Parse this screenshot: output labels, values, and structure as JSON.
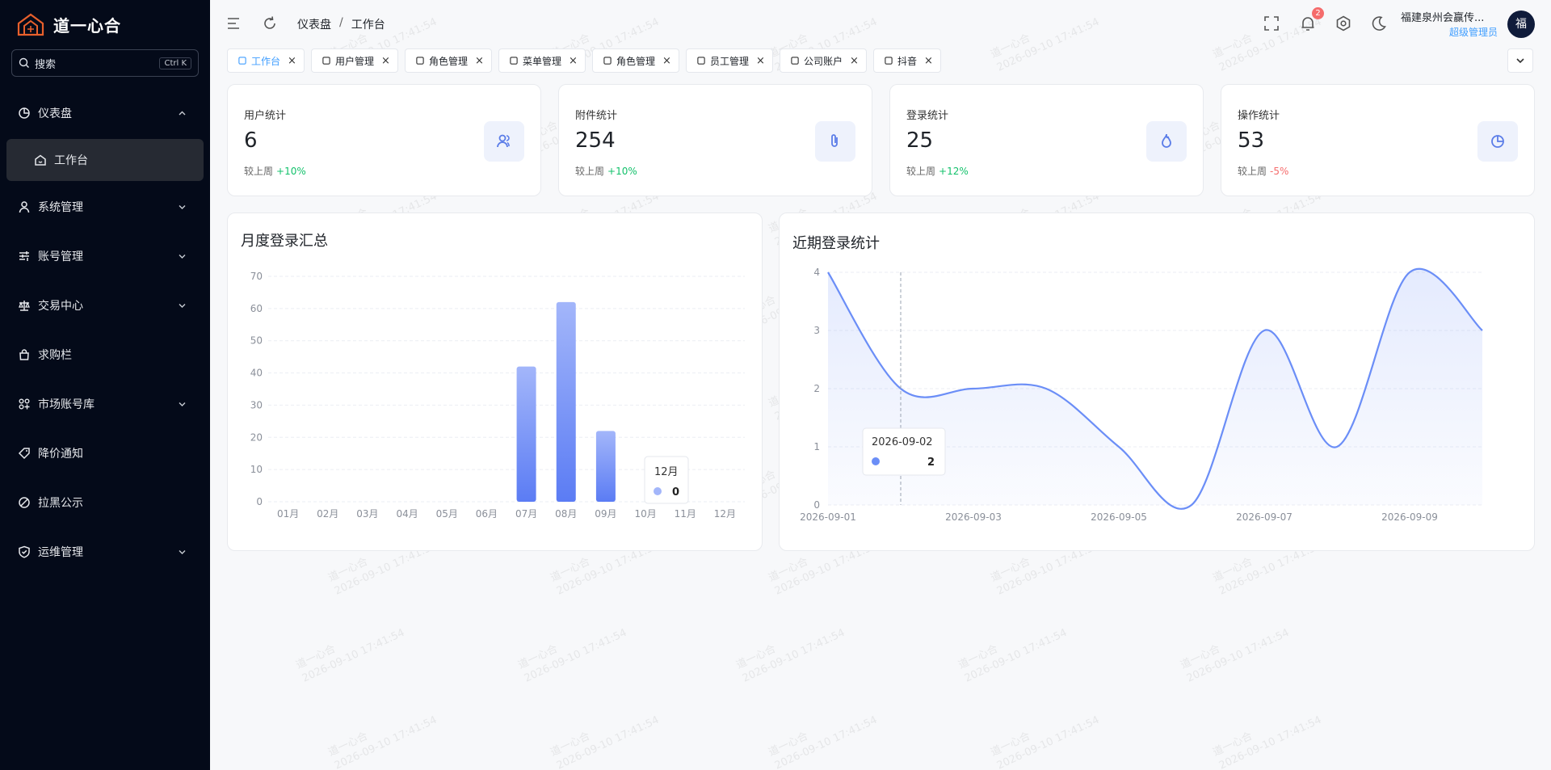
{
  "app": {
    "name": "道一心合"
  },
  "sidebar": {
    "search_placeholder": "搜索",
    "search_shortcut": "Ctrl K",
    "items": [
      {
        "label": "仪表盘",
        "icon": "dashboard-icon",
        "expanded": true
      },
      {
        "label": "工作台",
        "icon": "home-icon",
        "active": true
      },
      {
        "label": "系统管理",
        "icon": "user-icon"
      },
      {
        "label": "账号管理",
        "icon": "sliders-icon"
      },
      {
        "label": "交易中心",
        "icon": "scale-icon"
      },
      {
        "label": "求购栏",
        "icon": "bag-icon"
      },
      {
        "label": "市场账号库",
        "icon": "apps-icon"
      },
      {
        "label": "降价通知",
        "icon": "tag-icon"
      },
      {
        "label": "拉黑公示",
        "icon": "ban-icon"
      },
      {
        "label": "运维管理",
        "icon": "shield-icon"
      }
    ]
  },
  "header": {
    "breadcrumb": [
      "仪表盘",
      "工作台"
    ],
    "notification_count": "2",
    "user_name": "福建泉州会赢传...",
    "user_role": "超级管理员",
    "avatar_text": "福"
  },
  "tabs": [
    {
      "label": "工作台",
      "active": true
    },
    {
      "label": "用户管理"
    },
    {
      "label": "角色管理"
    },
    {
      "label": "菜单管理"
    },
    {
      "label": "角色管理"
    },
    {
      "label": "员工管理"
    },
    {
      "label": "公司账户"
    },
    {
      "label": "抖音"
    }
  ],
  "stats": [
    {
      "title": "用户统计",
      "value": "6",
      "foot": "较上周",
      "change": "+10%",
      "trend": "up",
      "icon": "users-icon"
    },
    {
      "title": "附件统计",
      "value": "254",
      "foot": "较上周",
      "change": "+10%",
      "trend": "up",
      "icon": "paperclip-icon"
    },
    {
      "title": "登录统计",
      "value": "25",
      "foot": "较上周",
      "change": "+12%",
      "trend": "up",
      "icon": "flame-icon"
    },
    {
      "title": "操作统计",
      "value": "53",
      "foot": "较上周",
      "change": "-5%",
      "trend": "down",
      "icon": "pie-icon"
    }
  ],
  "watermark": {
    "line1": "道一心合",
    "line2": "2026-09-10 17:41:54"
  },
  "colors": {
    "accent": "#409eff",
    "bar": "#6b8ef7",
    "line": "#6b8ef7",
    "up": "#13c16b",
    "down": "#f56c6c"
  },
  "chart_data": [
    {
      "type": "bar",
      "title": "月度登录汇总",
      "categories": [
        "01月",
        "02月",
        "03月",
        "04月",
        "05月",
        "06月",
        "07月",
        "08月",
        "09月",
        "10月",
        "11月",
        "12月"
      ],
      "values": [
        0,
        0,
        0,
        0,
        0,
        0,
        42,
        62,
        22,
        0,
        0,
        0
      ],
      "ylim": [
        0,
        70
      ],
      "yticks": [
        0,
        10,
        20,
        30,
        40,
        50,
        60,
        70
      ],
      "tooltip": {
        "label": "12月",
        "value": "0"
      }
    },
    {
      "type": "area",
      "title": "近期登录统计",
      "x": [
        "2026-09-01",
        "2026-09-02",
        "2026-09-03",
        "2026-09-04",
        "2026-09-05",
        "2026-09-06",
        "2026-09-07",
        "2026-09-08",
        "2026-09-09",
        "2026-09-10"
      ],
      "xtick_labels": [
        "2026-09-01",
        "2026-09-03",
        "2026-09-05",
        "2026-09-07",
        "2026-09-09"
      ],
      "values": [
        4,
        2,
        2,
        2,
        1,
        0,
        3,
        1,
        4,
        3
      ],
      "ylim": [
        0,
        4
      ],
      "yticks": [
        0,
        1,
        2,
        3,
        4
      ],
      "tooltip": {
        "label": "2026-09-02",
        "value": "2"
      }
    }
  ]
}
